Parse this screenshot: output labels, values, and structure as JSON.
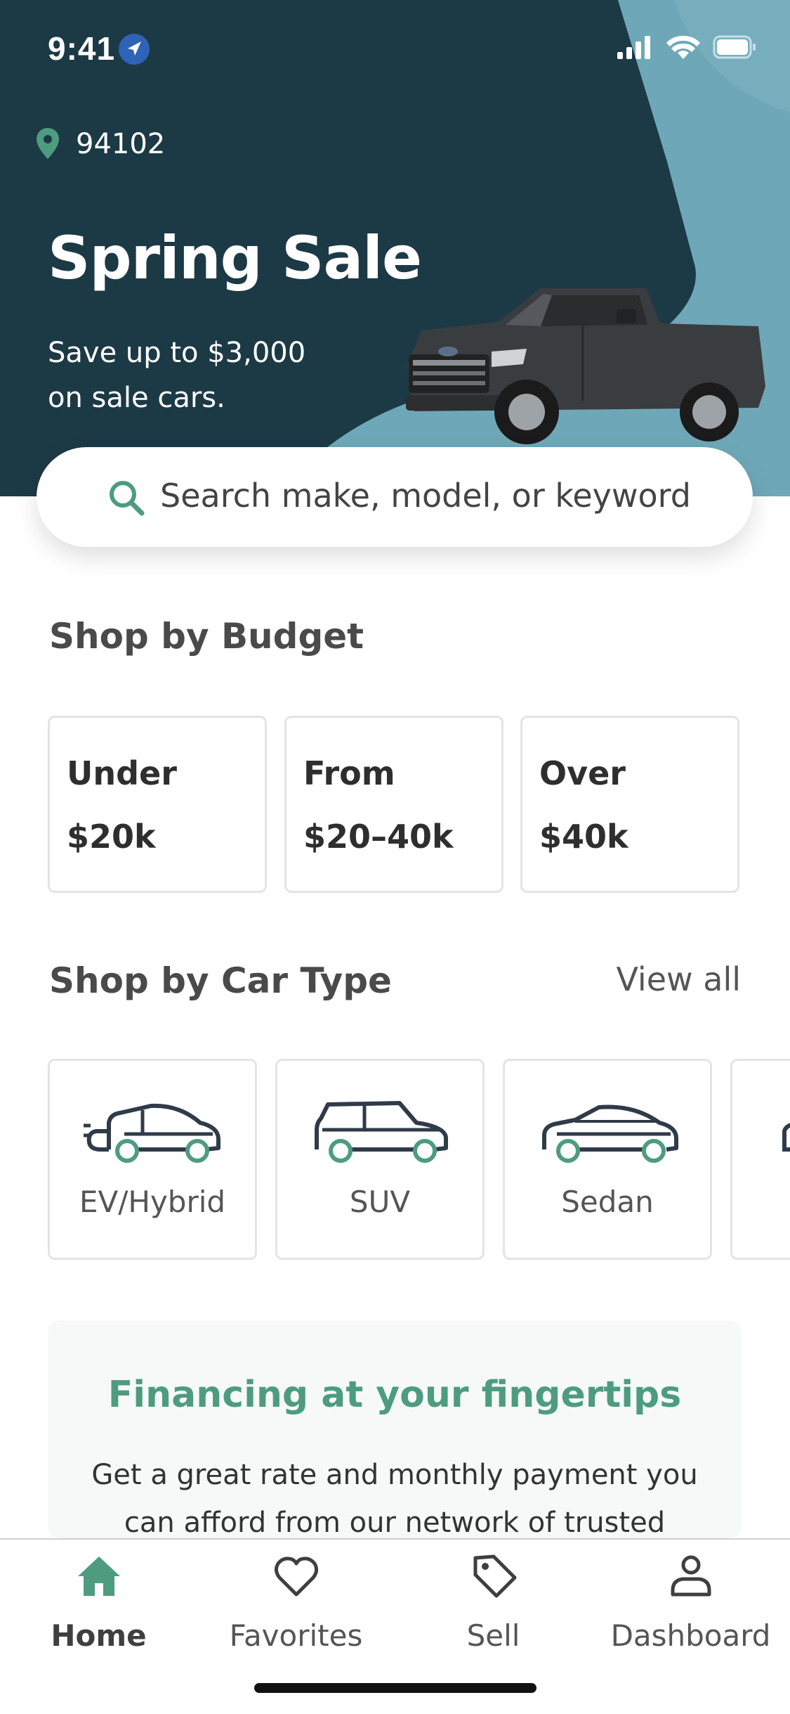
{
  "status_bar": {
    "time": "9:41"
  },
  "location": {
    "zip": "94102",
    "icon": "map-pin-icon"
  },
  "hero": {
    "title": "Spring Sale",
    "subtitle": "Save up to $3,000 on sale cars.",
    "image": "pickup-truck"
  },
  "search": {
    "placeholder": "Search make, model, or keyword",
    "icon": "search-icon"
  },
  "budget": {
    "title": "Shop by Budget",
    "cards": [
      {
        "line1": "Under",
        "line2": "$20k"
      },
      {
        "line1": "From",
        "line2": "$20–40k"
      },
      {
        "line1": "Over",
        "line2": "$40k"
      }
    ]
  },
  "car_type": {
    "title": "Shop by Car Type",
    "view_all": "View all",
    "cards": [
      {
        "label": "EV/Hybrid",
        "icon": "ev-car-icon"
      },
      {
        "label": "SUV",
        "icon": "suv-icon"
      },
      {
        "label": "Sedan",
        "icon": "sedan-icon"
      }
    ]
  },
  "financing": {
    "title": "Financing at your fingertips",
    "body": "Get a great rate and monthly payment you can afford from our network of trusted"
  },
  "tabbar": {
    "tabs": [
      {
        "label": "Home",
        "icon": "home-icon",
        "active": true
      },
      {
        "label": "Favorites",
        "icon": "heart-icon",
        "active": false
      },
      {
        "label": "Sell",
        "icon": "tag-icon",
        "active": false
      },
      {
        "label": "Dashboard",
        "icon": "user-icon",
        "active": false
      }
    ]
  },
  "colors": {
    "hero_bg": "#1c3a45",
    "hero_accent": "#6ea8b8",
    "brand_green": "#4e9c80",
    "text_dark": "#3d3d3d"
  }
}
